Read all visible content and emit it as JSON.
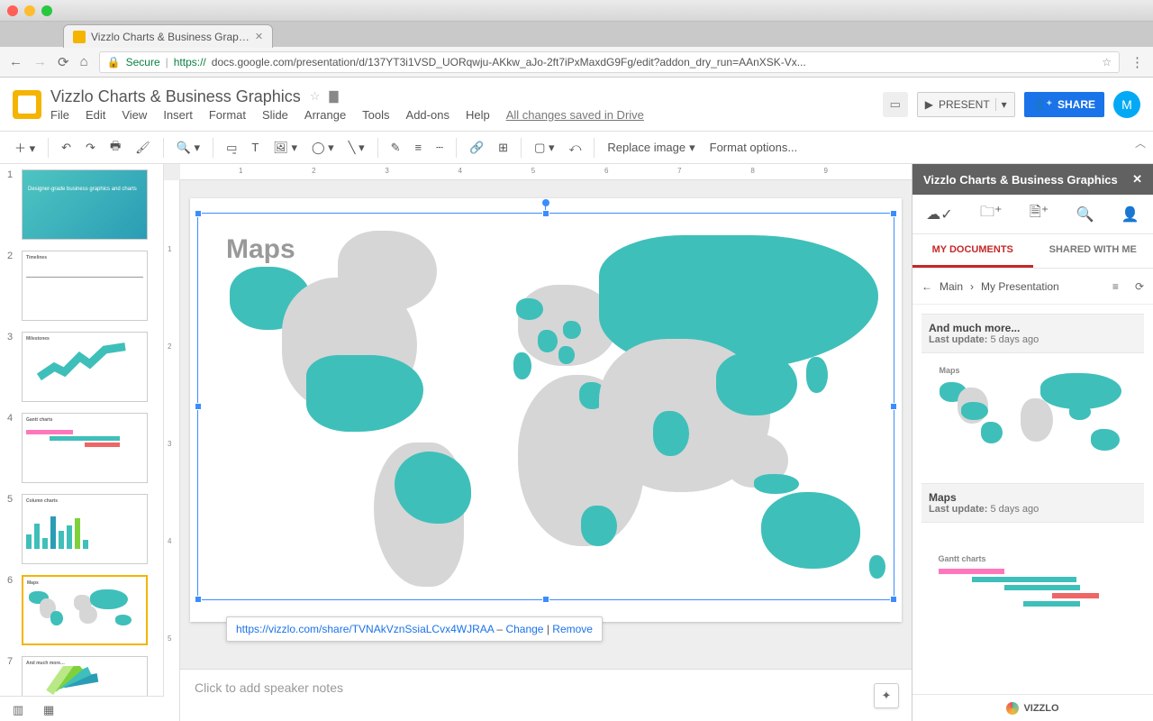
{
  "browser": {
    "tab_title": "Vizzlo Charts & Business Grap…",
    "secure_label": "Secure",
    "url_prefix": "https://",
    "url": "docs.google.com/presentation/d/137YT3i1VSD_UORqwju-AKkw_aJo-2ft7iPxMaxdG9Fg/edit?addon_dry_run=AAnXSK-Vx..."
  },
  "doc": {
    "title": "Vizzlo Charts & Business Graphics",
    "menus": [
      "File",
      "Edit",
      "View",
      "Insert",
      "Format",
      "Slide",
      "Arrange",
      "Tools",
      "Add-ons",
      "Help"
    ],
    "saved": "All changes saved in Drive",
    "present": "PRESENT",
    "share": "SHARE",
    "avatar_letter": "M"
  },
  "toolbar": {
    "replace_image": "Replace image",
    "format_options": "Format options..."
  },
  "thumbs": [
    {
      "n": "1",
      "label": "Designer-grade business graphics and charts"
    },
    {
      "n": "2",
      "label": "Timelines"
    },
    {
      "n": "3",
      "label": "Milestones"
    },
    {
      "n": "4",
      "label": "Gantt charts"
    },
    {
      "n": "5",
      "label": "Column charts"
    },
    {
      "n": "6",
      "label": "Maps"
    },
    {
      "n": "7",
      "label": "And much more…"
    }
  ],
  "canvas": {
    "title": "Maps",
    "link_url": "https://vizzlo.com/share/TVNAkVznSsiaLCvx4WJRAA",
    "sep": " – ",
    "change": "Change",
    "pipe": " | ",
    "remove": "Remove",
    "notes_placeholder": "Click to add speaker notes"
  },
  "rpanel": {
    "title": "Vizzlo Charts & Business Graphics",
    "tabs": {
      "my": "MY DOCUMENTS",
      "shared": "SHARED WITH ME"
    },
    "crumb_main": "Main",
    "crumb_pres": "My Presentation",
    "cards": [
      {
        "title": "And much more...",
        "sub_prefix": "Last update:",
        "sub_value": " 5 days ago"
      },
      {
        "title": "Maps",
        "sub_prefix": "Last update:",
        "sub_value": " 5 days ago"
      },
      {
        "title": "Gantt charts",
        "sub_prefix": "",
        "sub_value": ""
      }
    ],
    "footer": "VIZZLO"
  },
  "ruler": {
    "h": [
      "1",
      "2",
      "3",
      "4",
      "5",
      "6",
      "7",
      "8",
      "9"
    ],
    "v": [
      "1",
      "2",
      "3",
      "4",
      "5"
    ]
  }
}
